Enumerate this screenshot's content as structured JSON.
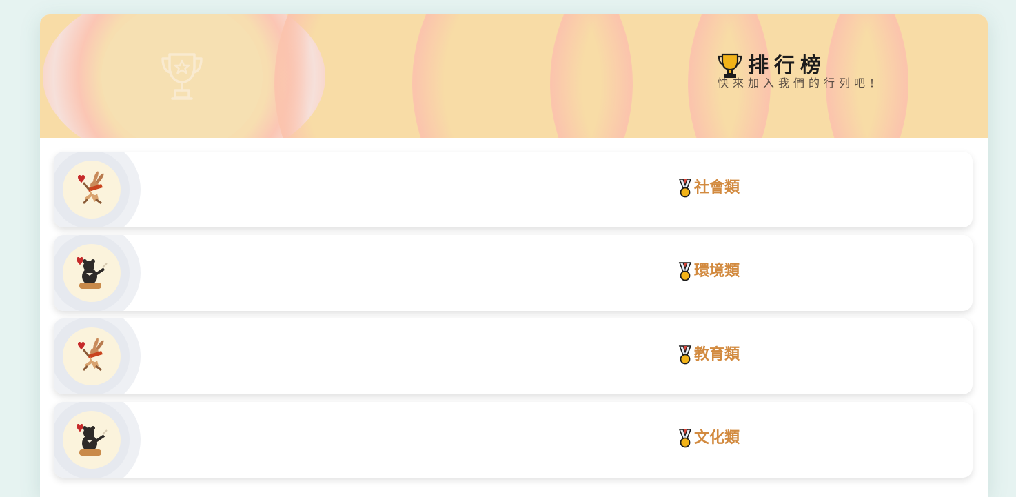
{
  "header": {
    "title": "排行榜",
    "subtitle": "快來加入我們的行列吧！",
    "title_icon": "trophy-icon",
    "decor_icon": "trophy-outline-icon"
  },
  "leaderboard": {
    "rows": [
      {
        "category": "社會類",
        "avatar": "rabbit-avatar-icon",
        "badge": "medal-icon"
      },
      {
        "category": "環境類",
        "avatar": "bear-avatar-icon",
        "badge": "medal-icon"
      },
      {
        "category": "教育類",
        "avatar": "rabbit-avatar-icon",
        "badge": "medal-icon"
      },
      {
        "category": "文化類",
        "avatar": "bear-avatar-icon",
        "badge": "medal-icon"
      }
    ]
  },
  "colors": {
    "background": "#e6f3f1",
    "banner": "#f8dca6",
    "banner_ring": "#fbc3ad",
    "category_text": "#d28a3f",
    "trophy_gold": "#f2b318"
  }
}
